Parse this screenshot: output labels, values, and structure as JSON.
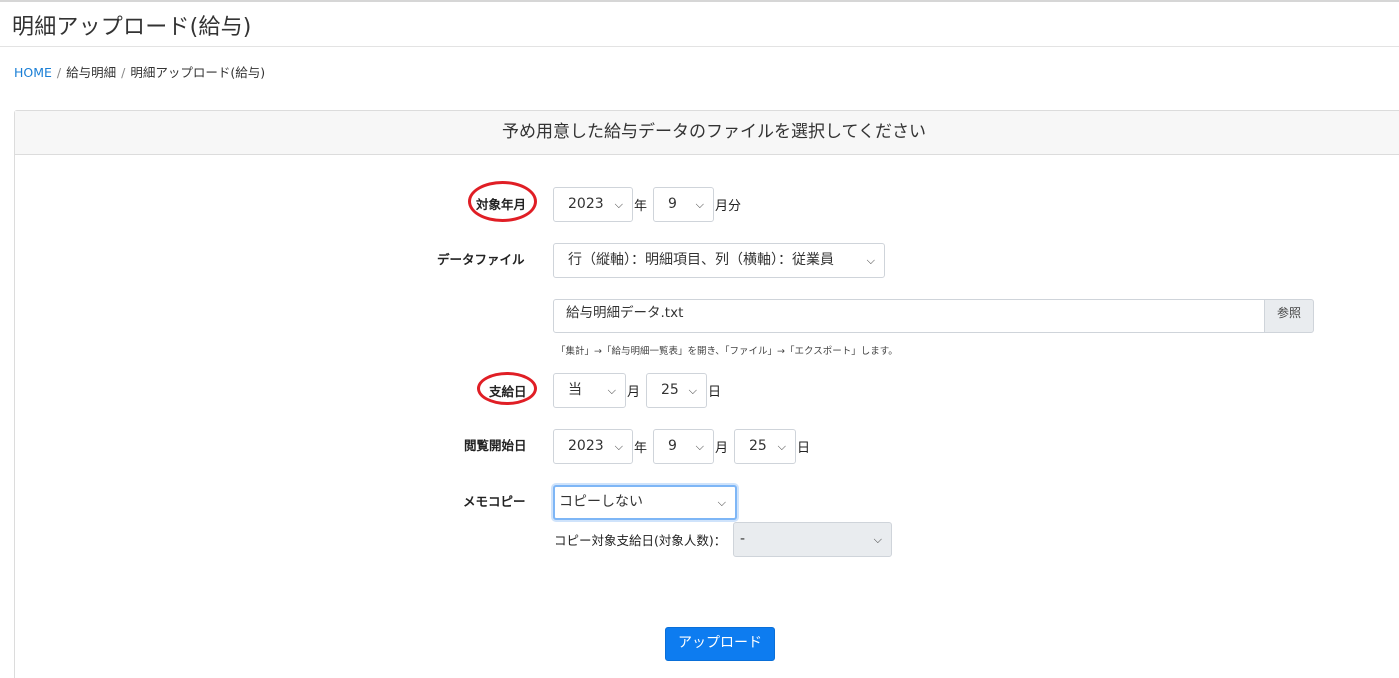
{
  "page": {
    "title": "明細アップロード(給与)"
  },
  "breadcrumb": {
    "home": "HOME",
    "separator": "/",
    "level1": "給与明細",
    "current": "明細アップロード(給与)"
  },
  "card": {
    "header": "予め用意した給与データのファイルを選択してください"
  },
  "form": {
    "target_month": {
      "label": "対象年月",
      "year": "2023",
      "year_unit": "年",
      "month": "9",
      "month_unit": "月分"
    },
    "data_file": {
      "label": "データファイル",
      "layout": "行（縦軸）：明細項目、列（横軸）：従業員",
      "file_name": "給与明細データ.txt",
      "browse": "参照",
      "hint": "「集計」→「給与明細一覧表」を開き、「ファイル」→「エクスポート」します。"
    },
    "pay_day": {
      "label": "支給日",
      "month": "当",
      "month_unit": "月",
      "day": "25",
      "day_unit": "日"
    },
    "view_start": {
      "label": "閲覧開始日",
      "year": "2023",
      "year_unit": "年",
      "month": "9",
      "month_unit": "月",
      "day": "25",
      "day_unit": "日"
    },
    "memo_copy": {
      "label": "メモコピー",
      "value": "コピーしない",
      "copy_target_label": "コピー対象支給日(対象人数)：",
      "copy_target_value": "-"
    }
  },
  "upload_button": "アップロード",
  "colors": {
    "accent": "#0d7cf0",
    "link": "#1a7fd6",
    "highlight_ring": "#e01e25"
  }
}
